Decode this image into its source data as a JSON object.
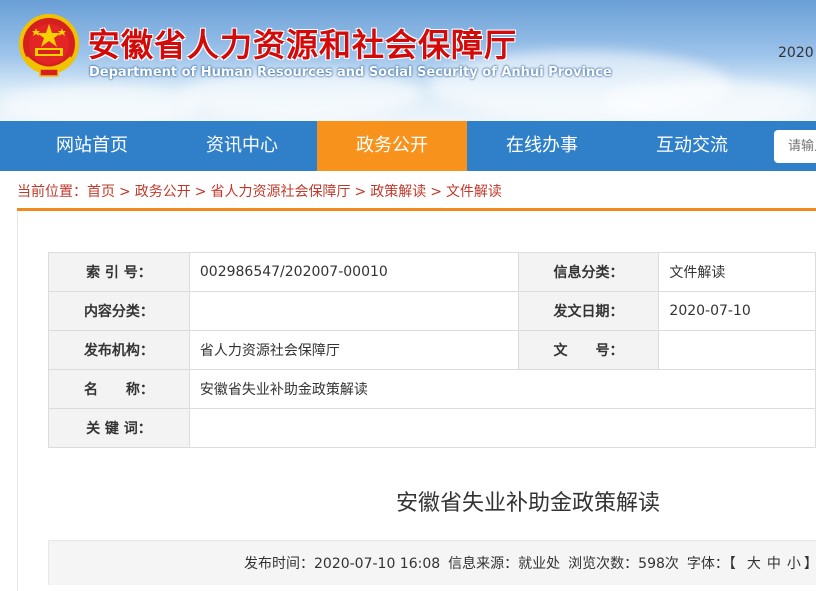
{
  "header": {
    "title_cn": "安徽省人力资源和社会保障厅",
    "title_en": "Department of Human Resources and Social Security of Anhui Province",
    "date": "2020"
  },
  "nav": {
    "items": [
      "网站首页",
      "资讯中心",
      "政务公开",
      "在线办事",
      "互动交流"
    ],
    "active_index": 2,
    "search_placeholder": "请输入"
  },
  "breadcrumb": {
    "prefix": "当前位置：",
    "items": [
      "首页",
      "政务公开",
      "省人力资源社会保障厅",
      "政策解读",
      "文件解读"
    ],
    "separator": ">"
  },
  "meta": {
    "index_label": "索 引 号：",
    "index_value": "002986547/202007-00010",
    "info_category_label": "信息分类：",
    "info_category_value": "文件解读",
    "content_category_label": "内容分类：",
    "content_category_value": "",
    "issue_date_label": "发文日期：",
    "issue_date_value": "2020-07-10",
    "publisher_label": "发布机构：",
    "publisher_value": "省人力资源社会保障厅",
    "doc_number_label": "文　　号：",
    "doc_number_value": "",
    "name_label": "名　　称：",
    "name_value": "安徽省失业补助金政策解读",
    "keywords_label": "关 键 词：",
    "keywords_value": ""
  },
  "article": {
    "title": "安徽省失业补助金政策解读"
  },
  "info_bar": {
    "publish_time": "发布时间：2020-07-10 16:08",
    "source": "信息来源：就业处",
    "views": "浏览次数：598次",
    "font_label": "字体：【",
    "font_large": "大",
    "font_medium": "中",
    "font_small": "小",
    "font_close": "】"
  },
  "colors": {
    "nav_bg": "#2f80c8",
    "nav_active": "#f7931d",
    "title_red": "#d20a0a",
    "breadcrumb_red": "#c0392b",
    "rule_orange": "#f08a1c"
  }
}
